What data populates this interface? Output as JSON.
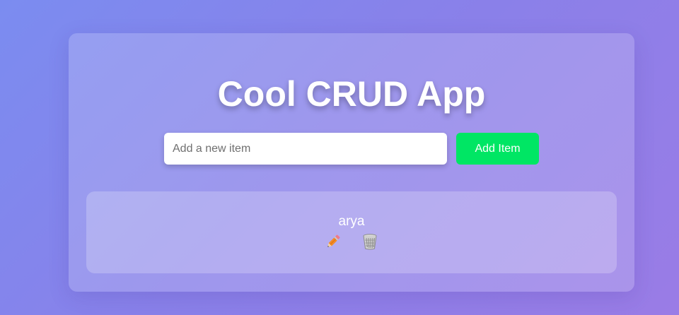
{
  "app": {
    "title": "Cool CRUD App"
  },
  "form": {
    "placeholder": "Add a new item",
    "value": "",
    "add_label": "Add Item"
  },
  "items": [
    {
      "label": "arya",
      "edit_icon": "pencil-icon",
      "delete_icon": "wastebasket-icon"
    }
  ],
  "colors": {
    "add_button": "#00e664",
    "background_start": "#7b8cf0",
    "background_end": "#9a7ce6"
  }
}
